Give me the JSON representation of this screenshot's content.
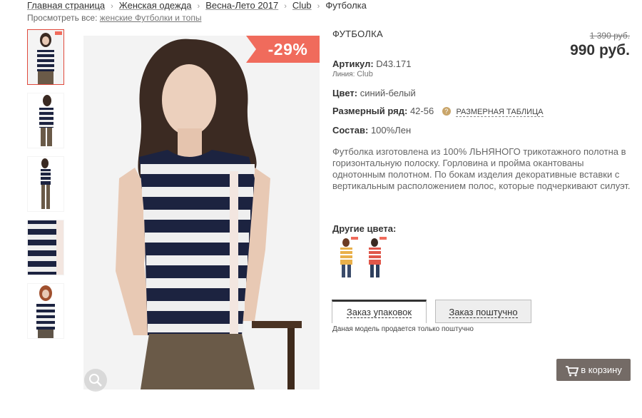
{
  "breadcrumb": [
    "Главная страница",
    "Женская одежда",
    "Весна-Лето 2017",
    "Club",
    "Футболка"
  ],
  "breadcrumb_sep": "›",
  "view_all": {
    "label": "Просмотреть все:",
    "link": "женские Футболки и топы"
  },
  "product": {
    "title": "ФУТБОЛКА",
    "old_price": "1 390 руб.",
    "price": "990 руб.",
    "discount": "-29%",
    "article_label": "Артикул:",
    "article_value": "D43.171",
    "line_label": "Линия:",
    "line_value": "Club",
    "color_label": "Цвет:",
    "color_value": "синий-белый",
    "size_label": "Размерный ряд:",
    "size_value": "42-56",
    "size_chart_link": "РАЗМЕРНАЯ ТАБЛИЦА",
    "composition_label": "Состав:",
    "composition_value": "100%Лен",
    "description": "Футболка изготовлена из 100% ЛЬНЯНОГО трикотажного полотна в горизонтальную полоску. Горловина и пройма окантованы однотонным полотном. По бокам изделия декоративные вставки с вертикальным расположением полос, которые подчеркивают силуэт."
  },
  "other_colors_label": "Другие цвета:",
  "order_tabs": {
    "pack": "Заказ упаковок",
    "piece": "Заказ поштучно"
  },
  "order_note": "Даная модель продается только поштучно",
  "cart_button": "в корзину",
  "icons": {
    "zoom": "zoom-icon",
    "cart": "cart-icon",
    "help": "question-icon"
  },
  "colors": {
    "accent": "#f06b5c",
    "cart_bg": "#746b66",
    "active_thumb": "#e0493c",
    "navy": "#1c2340"
  }
}
